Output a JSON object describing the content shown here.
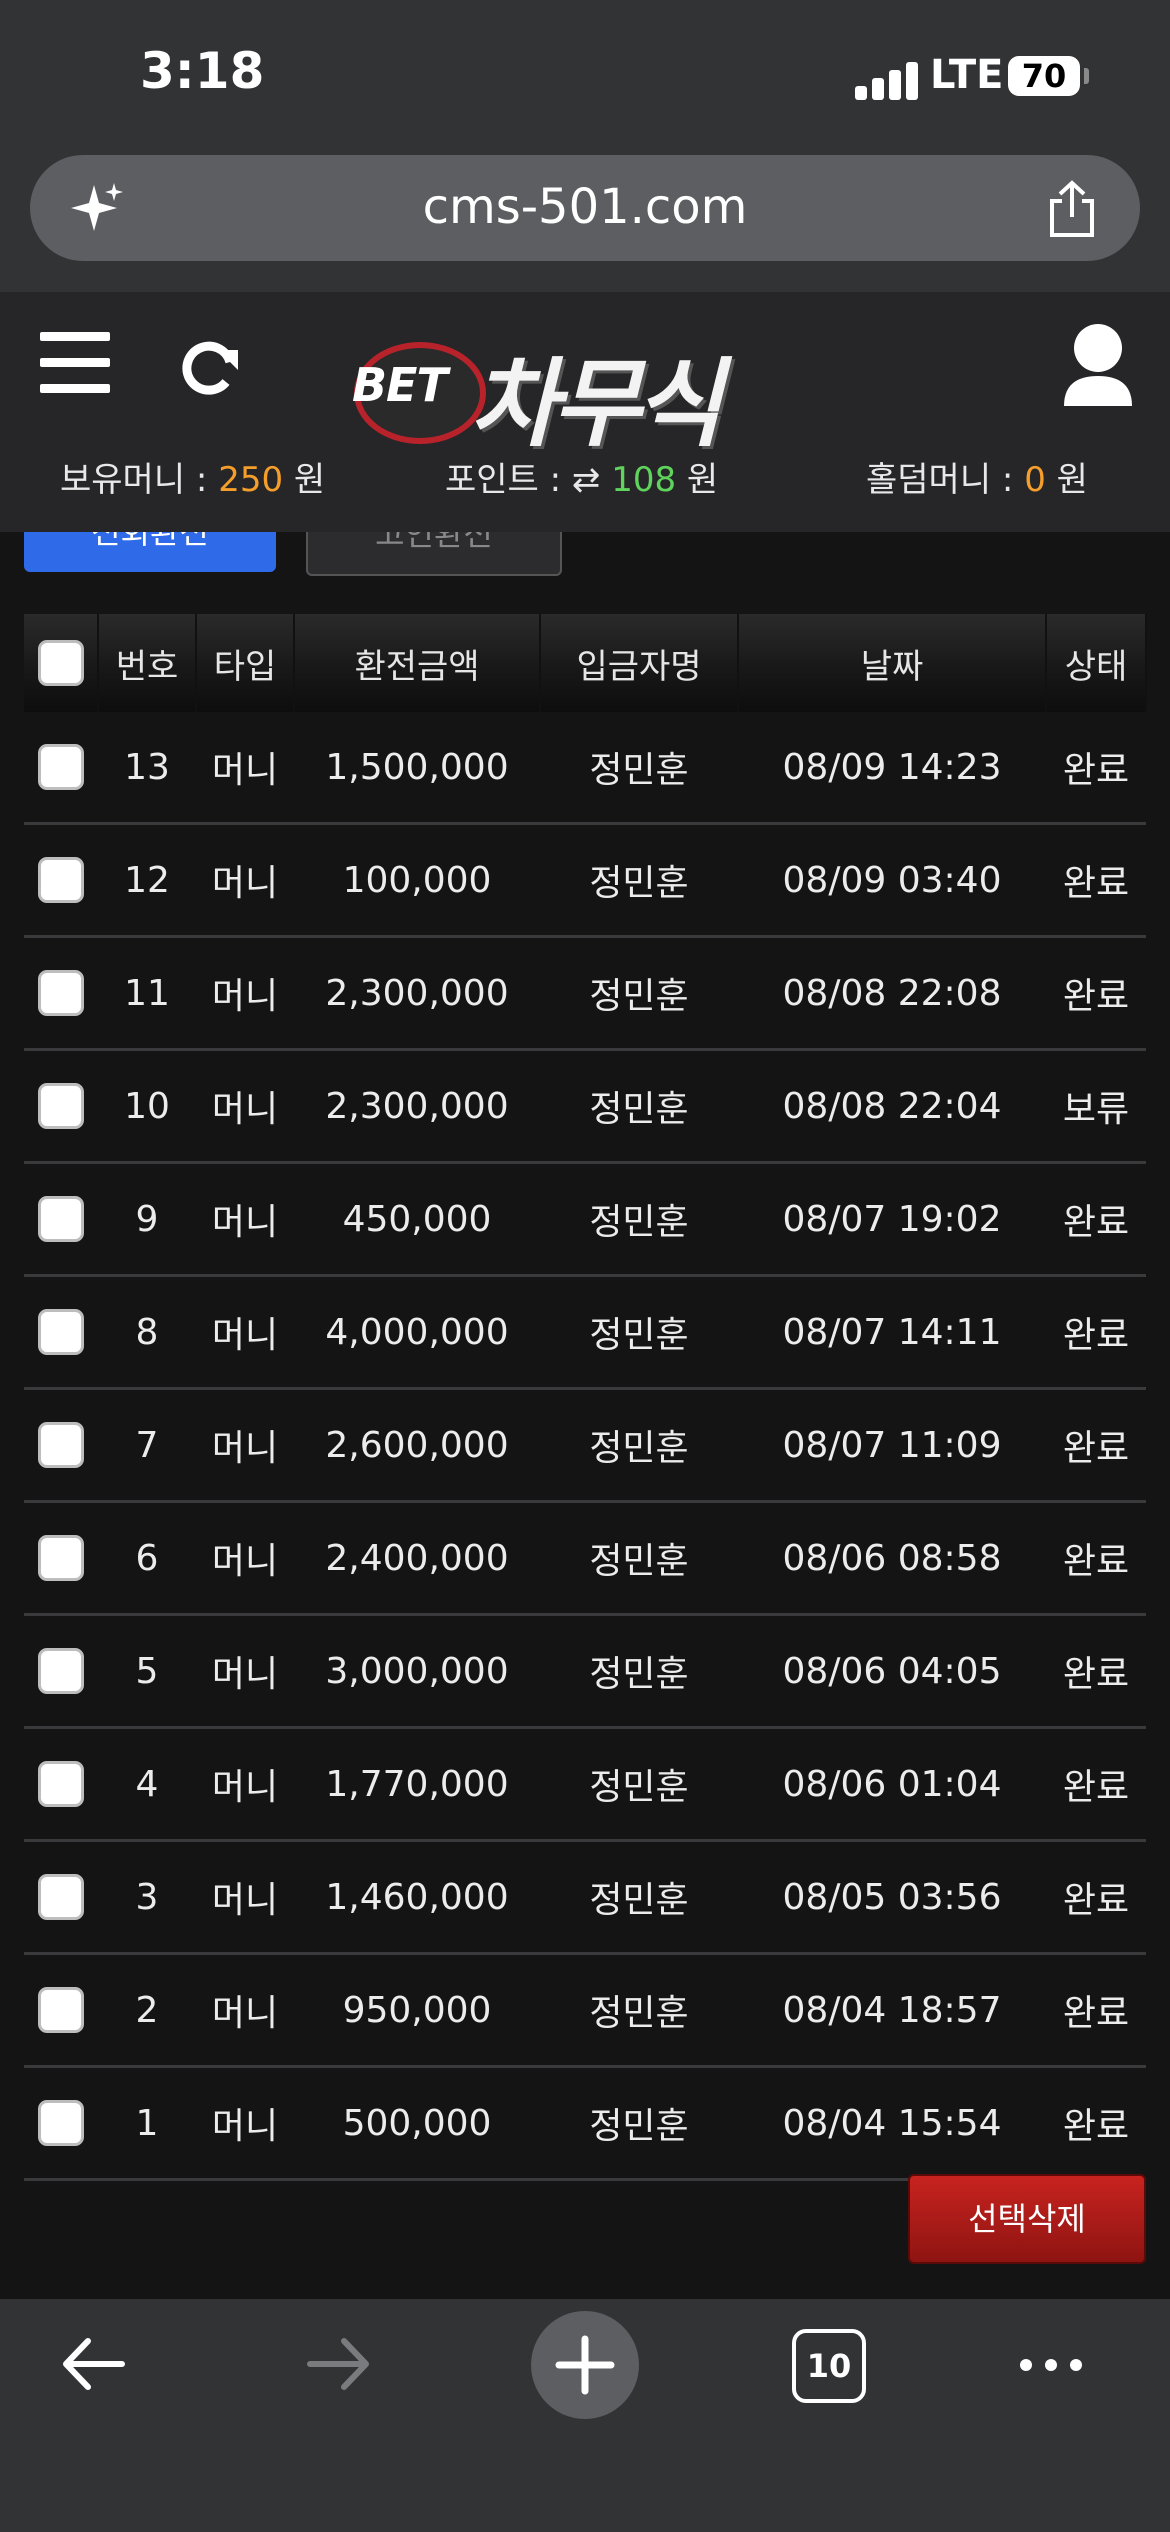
{
  "status": {
    "time": "3:18",
    "network": "LTE",
    "battery": "70"
  },
  "browser": {
    "url": "cms-501.com",
    "tab_count": "10"
  },
  "site": {
    "logo_badge": "BET",
    "logo_title": "차무식",
    "balance": {
      "money_label": "보유머니 : ",
      "money_value": "250",
      "money_unit": " 원",
      "point_label": "포인트 : ",
      "point_value": "108",
      "point_unit": " 원",
      "holdem_label": "홀덤머니 : ",
      "holdem_value": "0",
      "holdem_unit": " 원"
    }
  },
  "tabs": [
    "전회환전",
    "고인환전"
  ],
  "table": {
    "headers": [
      "번호",
      "타입",
      "환전금액",
      "입금자명",
      "날짜",
      "상태"
    ],
    "rows": [
      [
        "13",
        "머니",
        "1,500,000",
        "정민훈",
        "08/09 14:23",
        "완료"
      ],
      [
        "12",
        "머니",
        "100,000",
        "정민훈",
        "08/09 03:40",
        "완료"
      ],
      [
        "11",
        "머니",
        "2,300,000",
        "정민훈",
        "08/08 22:08",
        "완료"
      ],
      [
        "10",
        "머니",
        "2,300,000",
        "정민훈",
        "08/08 22:04",
        "보류"
      ],
      [
        "9",
        "머니",
        "450,000",
        "정민훈",
        "08/07 19:02",
        "완료"
      ],
      [
        "8",
        "머니",
        "4,000,000",
        "정민훈",
        "08/07 14:11",
        "완료"
      ],
      [
        "7",
        "머니",
        "2,600,000",
        "정민훈",
        "08/07 11:09",
        "완료"
      ],
      [
        "6",
        "머니",
        "2,400,000",
        "정민훈",
        "08/06 08:58",
        "완료"
      ],
      [
        "5",
        "머니",
        "3,000,000",
        "정민훈",
        "08/06 04:05",
        "완료"
      ],
      [
        "4",
        "머니",
        "1,770,000",
        "정민훈",
        "08/06 01:04",
        "완료"
      ],
      [
        "3",
        "머니",
        "1,460,000",
        "정민훈",
        "08/05 03:56",
        "완료"
      ],
      [
        "2",
        "머니",
        "950,000",
        "정민훈",
        "08/04 18:57",
        "완료"
      ],
      [
        "1",
        "머니",
        "500,000",
        "정민훈",
        "08/04 15:54",
        "완료"
      ]
    ]
  },
  "actions": {
    "delete_selected": "선택삭제"
  },
  "colors": {
    "accent_orange": "#f59e2b",
    "accent_green": "#5fd35c",
    "tab_active": "#2f6be8",
    "danger": "#c8231f"
  }
}
